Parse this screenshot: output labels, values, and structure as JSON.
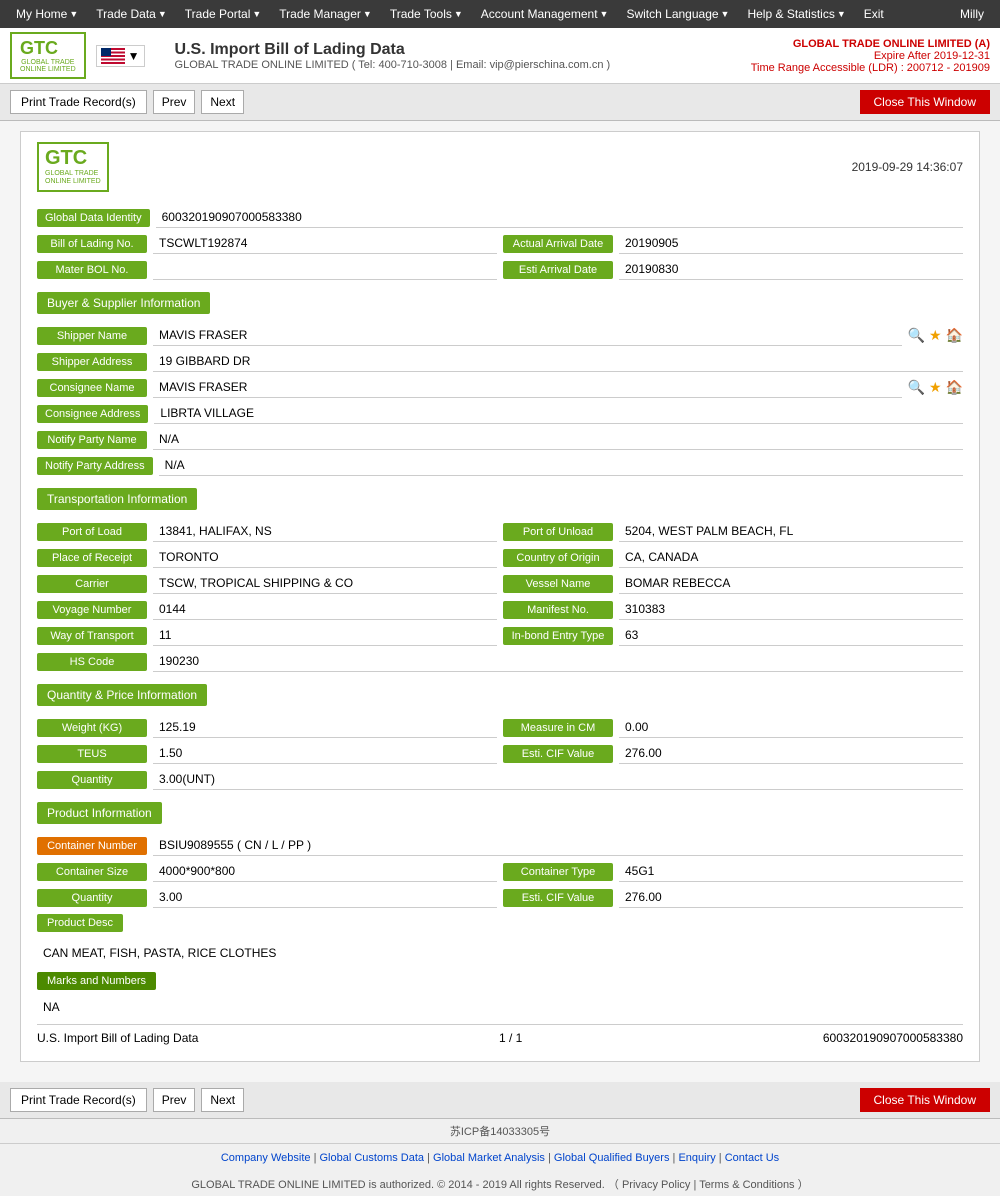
{
  "nav": {
    "items": [
      {
        "label": "My Home",
        "arrow": true
      },
      {
        "label": "Trade Data",
        "arrow": true
      },
      {
        "label": "Trade Portal",
        "arrow": true
      },
      {
        "label": "Trade Manager",
        "arrow": true
      },
      {
        "label": "Trade Tools",
        "arrow": true
      },
      {
        "label": "Account Management",
        "arrow": true
      },
      {
        "label": "Switch Language",
        "arrow": true
      },
      {
        "label": "Help & Statistics",
        "arrow": true
      },
      {
        "label": "Exit",
        "arrow": false
      }
    ],
    "user": "Milly"
  },
  "header": {
    "logo_text": "GTC",
    "logo_sub": "GLOBAL TRADE\nONLINE LIMITED",
    "title": "U.S. Import Bill of Lading Data",
    "subtitle": "GLOBAL TRADE ONLINE LIMITED ( Tel: 400-710-3008 | Email: vip@pierschina.com.cn )",
    "company": "GLOBAL TRADE ONLINE LIMITED (A)",
    "expire": "Expire After 2019-12-31",
    "time_range": "Time Range Accessible (LDR) : 200712 - 201909"
  },
  "actions": {
    "print_label": "Print Trade Record(s)",
    "prev_label": "Prev",
    "next_label": "Next",
    "close_label": "Close This Window"
  },
  "record": {
    "timestamp": "2019-09-29 14:36:07",
    "global_data_id_label": "Global Data Identity",
    "global_data_id_value": "600320190907000583380",
    "bol_no_label": "Bill of Lading No.",
    "bol_no_value": "TSCWLT192874",
    "actual_arrival_label": "Actual Arrival Date",
    "actual_arrival_value": "20190905",
    "master_bol_label": "Mater BOL No.",
    "master_bol_value": "",
    "esti_arrival_label": "Esti Arrival Date",
    "esti_arrival_value": "20190830",
    "buyer_supplier_section": "Buyer & Supplier Information",
    "shipper_name_label": "Shipper Name",
    "shipper_name_value": "MAVIS FRASER",
    "shipper_addr_label": "Shipper Address",
    "shipper_addr_value": "19 GIBBARD DR",
    "consignee_name_label": "Consignee Name",
    "consignee_name_value": "MAVIS FRASER",
    "consignee_addr_label": "Consignee Address",
    "consignee_addr_value": "LIBRTA VILLAGE",
    "notify_party_name_label": "Notify Party Name",
    "notify_party_name_value": "N/A",
    "notify_party_addr_label": "Notify Party Address",
    "notify_party_addr_value": "N/A",
    "transport_section": "Transportation Information",
    "port_of_load_label": "Port of Load",
    "port_of_load_value": "13841, HALIFAX, NS",
    "port_of_unload_label": "Port of Unload",
    "port_of_unload_value": "5204, WEST PALM BEACH, FL",
    "place_of_receipt_label": "Place of Receipt",
    "place_of_receipt_value": "TORONTO",
    "country_of_origin_label": "Country of Origin",
    "country_of_origin_value": "CA, CANADA",
    "carrier_label": "Carrier",
    "carrier_value": "TSCW, TROPICAL SHIPPING & CO",
    "vessel_name_label": "Vessel Name",
    "vessel_name_value": "BOMAR REBECCA",
    "voyage_number_label": "Voyage Number",
    "voyage_number_value": "0144",
    "manifest_no_label": "Manifest No.",
    "manifest_no_value": "310383",
    "way_of_transport_label": "Way of Transport",
    "way_of_transport_value": "11",
    "inbond_entry_label": "In-bond Entry Type",
    "inbond_entry_value": "63",
    "hs_code_label": "HS Code",
    "hs_code_value": "190230",
    "quantity_section": "Quantity & Price Information",
    "weight_label": "Weight (KG)",
    "weight_value": "125.19",
    "measure_cm_label": "Measure in CM",
    "measure_cm_value": "0.00",
    "teus_label": "TEUS",
    "teus_value": "1.50",
    "esti_cif_label": "Esti. CIF Value",
    "esti_cif_value": "276.00",
    "quantity_label": "Quantity",
    "quantity_value": "3.00(UNT)",
    "product_section": "Product Information",
    "container_number_label": "Container Number",
    "container_number_value": "BSIU9089555 ( CN / L / PP )",
    "container_size_label": "Container Size",
    "container_size_value": "4000*900*800",
    "container_type_label": "Container Type",
    "container_type_value": "45G1",
    "quantity2_label": "Quantity",
    "quantity2_value": "3.00",
    "esti_cif2_label": "Esti. CIF Value",
    "esti_cif2_value": "276.00",
    "product_desc_label": "Product Desc",
    "product_desc_value": "CAN MEAT, FISH, PASTA, RICE CLOTHES",
    "marks_label": "Marks and Numbers",
    "marks_value": "NA",
    "footer_title": "U.S. Import Bill of Lading Data",
    "footer_page": "1 / 1",
    "footer_id": "600320190907000583380"
  },
  "footer": {
    "icp": "苏ICP备14033305号",
    "links": [
      {
        "label": "Company Website"
      },
      {
        "label": "Global Customs Data"
      },
      {
        "label": "Global Market Analysis"
      },
      {
        "label": "Global Qualified Buyers"
      },
      {
        "label": "Enquiry"
      },
      {
        "label": "Contact Us"
      }
    ],
    "copyright": "GLOBAL TRADE ONLINE LIMITED is authorized. © 2014 - 2019 All rights Reserved.",
    "privacy": "Privacy Policy",
    "terms": "Terms & Conditions"
  }
}
